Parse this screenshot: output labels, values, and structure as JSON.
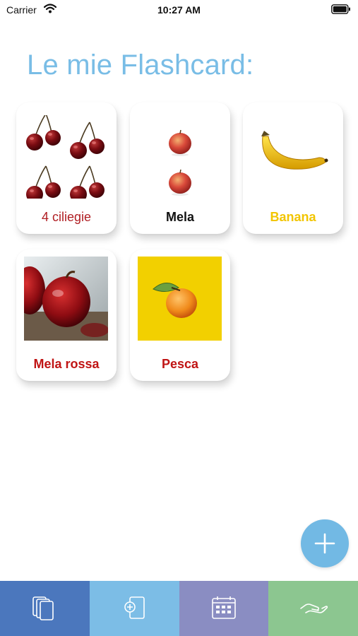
{
  "status_bar": {
    "carrier": "Carrier",
    "time": "10:27 AM"
  },
  "title": "Le mie Flashcard:",
  "cards": [
    {
      "label": "4 ciliegie",
      "label_color": "#b01e23",
      "image": "cherries"
    },
    {
      "label": "Mela",
      "label_color": "#111111",
      "image": "two-apples"
    },
    {
      "label": "Banana",
      "label_color": "#f2c500",
      "image": "banana"
    },
    {
      "label": "Mela rossa",
      "label_color": "#c01414",
      "image": "red-apple-photo"
    },
    {
      "label": "Pesca",
      "label_color": "#c01414",
      "image": "peach-on-yellow"
    }
  ],
  "fab": {
    "icon": "plus-icon"
  },
  "tabbar": {
    "tabs": [
      {
        "name": "flashcards",
        "icon": "cards-icon",
        "color": "#4b77bd"
      },
      {
        "name": "add-card",
        "icon": "add-card-icon",
        "color": "#7cbde6"
      },
      {
        "name": "calendar",
        "icon": "calendar-icon",
        "color": "#8a8dc2"
      },
      {
        "name": "hand",
        "icon": "hand-icon",
        "color": "#8cc690"
      }
    ]
  }
}
